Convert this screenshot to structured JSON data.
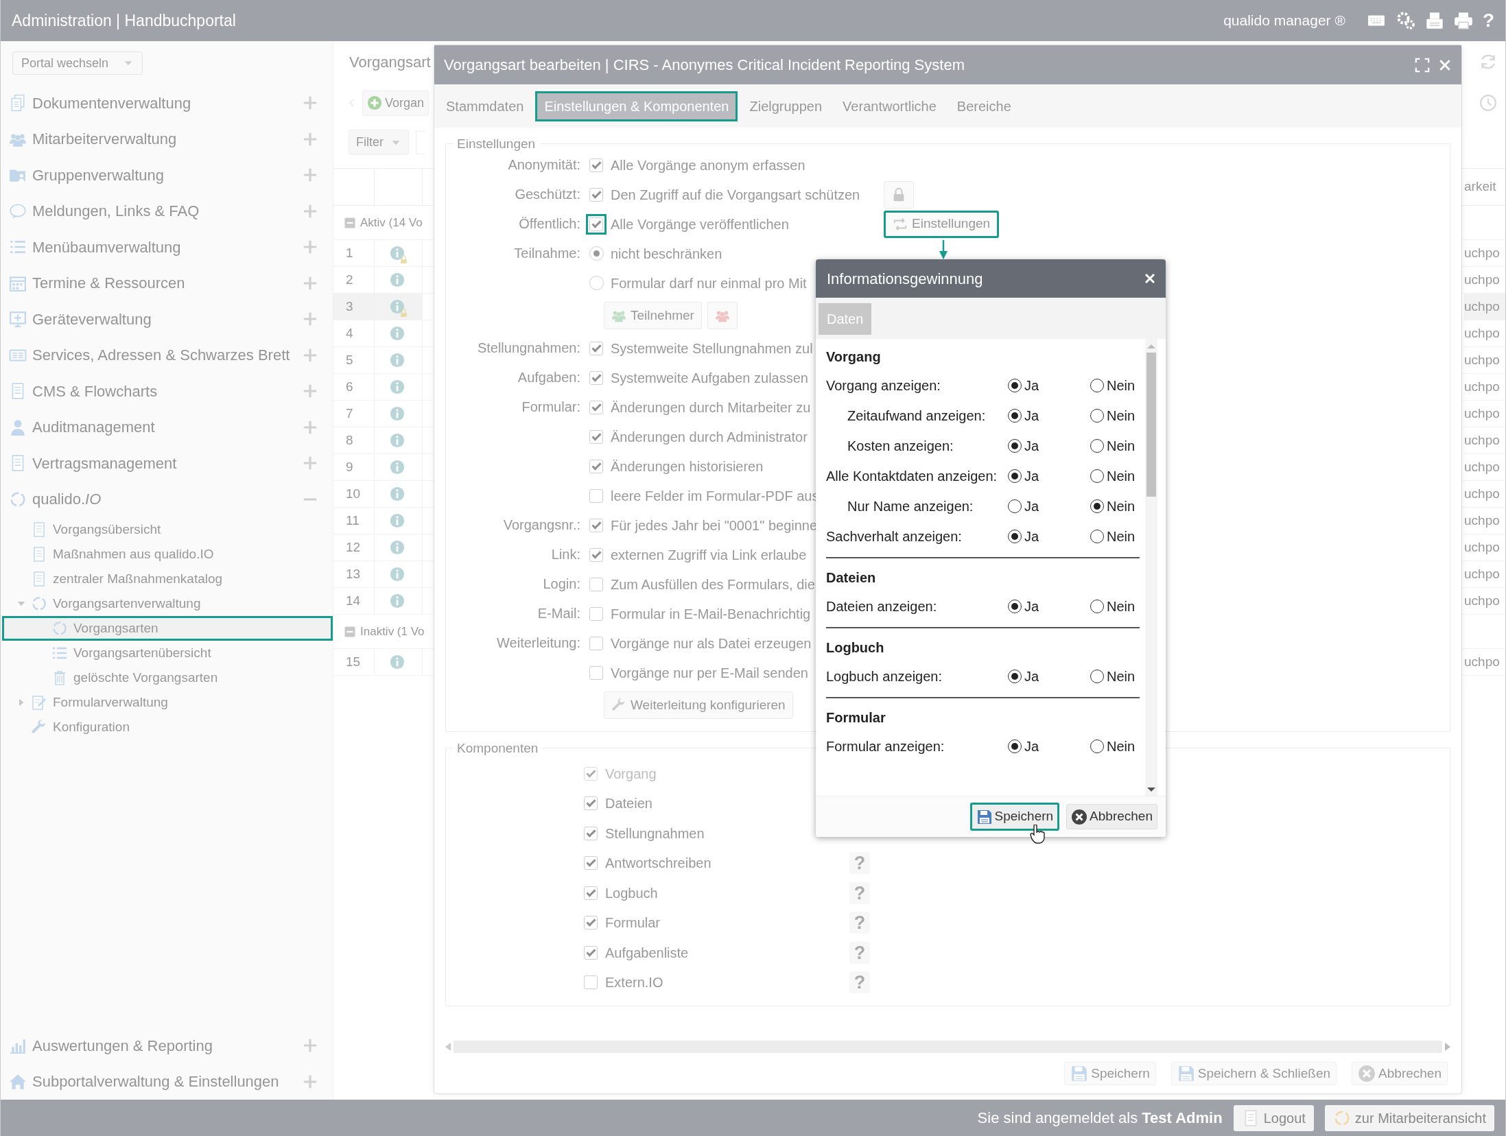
{
  "top_bar": {
    "title": "Administration | Handbuchportal",
    "product": "qualido manager ®",
    "help": "?"
  },
  "sidebar": {
    "portal_select": "Portal wechseln",
    "items": [
      {
        "label": "Dokumentenverwaltung",
        "expanded": false
      },
      {
        "label": "Mitarbeiterverwaltung",
        "expanded": false
      },
      {
        "label": "Gruppenverwaltung",
        "expanded": false
      },
      {
        "label": "Meldungen, Links & FAQ",
        "expanded": false
      },
      {
        "label": "Menübaumverwaltung",
        "expanded": false
      },
      {
        "label": "Termine & Ressourcen",
        "expanded": false
      },
      {
        "label": "Geräteverwaltung",
        "expanded": false
      },
      {
        "label": "Services, Adressen & Schwarzes Brett",
        "expanded": false
      },
      {
        "label": "CMS & Flowcharts",
        "expanded": false
      },
      {
        "label": "Auditmanagement",
        "expanded": false
      },
      {
        "label": "Vertragsmanagement",
        "expanded": false
      },
      {
        "label": "qualido.*IO*",
        "expanded": true,
        "children": [
          {
            "label": "Vorgangsübersicht",
            "selected": false
          },
          {
            "label": "Maßnahmen aus qualido.IO",
            "selected": false
          },
          {
            "label": "zentraler Maßnahmenkatalog",
            "selected": false
          },
          {
            "label": "Vorgangsartenverwaltung",
            "selected": false,
            "expanded": true,
            "children": [
              {
                "label": "Vorgangsarten",
                "selected": true,
                "highlighted": true
              },
              {
                "label": "Vorgangsartenübersicht",
                "selected": false,
                "highlighted": false
              },
              {
                "label": "gelöschte Vorgangsarten",
                "selected": false,
                "highlighted": false
              }
            ]
          },
          {
            "label": "Formularverwaltung",
            "selected": false,
            "expanded": false
          },
          {
            "label": "Konfiguration",
            "selected": false
          }
        ]
      }
    ],
    "bottom_items": [
      {
        "label": "Auswertungen & Reporting",
        "expanded": false
      },
      {
        "label": "Subportalverwaltung & Einstellungen",
        "expanded": false
      }
    ]
  },
  "list": {
    "title": "Vorgangsart",
    "add_button": "Vorgan",
    "filter": "Filter",
    "column_header": "arkeit",
    "groups": [
      {
        "label": "Aktiv (14 Vo",
        "expanded": true,
        "rows": [
          {
            "number": "1",
            "locked": true,
            "selected": false,
            "column_3": "uchpo"
          },
          {
            "number": "2",
            "locked": false,
            "selected": false,
            "column_3": "uchpo"
          },
          {
            "number": "3",
            "locked": true,
            "selected": true,
            "column_3": "uchpo"
          },
          {
            "number": "4",
            "locked": false,
            "selected": false,
            "column_3": "uchpo"
          },
          {
            "number": "5",
            "locked": false,
            "selected": false,
            "column_3": "uchpo"
          },
          {
            "number": "6",
            "locked": false,
            "selected": false,
            "column_3": "uchpo"
          },
          {
            "number": "7",
            "locked": false,
            "selected": false,
            "column_3": "uchpo"
          },
          {
            "number": "8",
            "locked": false,
            "selected": false,
            "column_3": "uchpo"
          },
          {
            "number": "9",
            "locked": false,
            "selected": false,
            "column_3": "uchpo"
          },
          {
            "number": "10",
            "locked": false,
            "selected": false,
            "column_3": "uchpo"
          },
          {
            "number": "11",
            "locked": false,
            "selected": false,
            "column_3": "uchpo"
          },
          {
            "number": "12",
            "locked": false,
            "selected": false,
            "column_3": "uchpo"
          },
          {
            "number": "13",
            "locked": false,
            "selected": false,
            "column_3": "uchpo"
          },
          {
            "number": "14",
            "locked": false,
            "selected": false,
            "column_3": "uchpo"
          }
        ]
      },
      {
        "label": "Inaktiv (1 Vo",
        "expanded": true,
        "rows": [
          {
            "number": "15",
            "locked": false,
            "selected": false,
            "column_3": "uchpo"
          }
        ]
      }
    ]
  },
  "dialog": {
    "title": "Vorgangsart bearbeiten | CIRS - Anonymes Critical Incident Reporting System",
    "tabs": [
      {
        "label": "Stammdaten",
        "selected": false,
        "highlighted": false
      },
      {
        "label": "Einstellungen & Komponenten",
        "selected": true,
        "highlighted": true
      },
      {
        "label": "Zielgruppen",
        "selected": false,
        "highlighted": false
      },
      {
        "label": "Verantwortliche",
        "selected": false,
        "highlighted": false
      },
      {
        "label": "Bereiche",
        "selected": false,
        "highlighted": false
      }
    ],
    "settings": {
      "legend": "Einstellungen",
      "groups": [
        {
          "label": "Anonymität:",
          "items": [
            {
              "kind": "checkbox",
              "text": "Alle Vorgänge anonym erfassen",
              "checked": true,
              "highlighted": false
            }
          ]
        },
        {
          "label": "Geschützt:",
          "items": [
            {
              "kind": "checkbox",
              "text": "Den Zugriff auf die Vorgangsart schützen",
              "checked": true,
              "highlighted": false,
              "button": {
                "kind": "lock",
                "highlighted": false
              }
            }
          ]
        },
        {
          "label": "Öffentlich:",
          "items": [
            {
              "kind": "checkbox",
              "text": "Alle Vorgänge veröffentlichen",
              "checked": true,
              "highlighted": true,
              "button": {
                "kind": "settings",
                "label": "Einstellungen",
                "highlighted": true
              }
            }
          ]
        },
        {
          "label": "Teilnahme:",
          "items": [
            {
              "kind": "radio",
              "text": "nicht beschränken",
              "selected": true,
              "highlighted": false
            },
            {
              "kind": "radio",
              "text": "Formular darf nur einmal pro Mit",
              "selected": false,
              "highlighted": false
            },
            {
              "kind": "buttons",
              "buttons": [
                {
                  "kind": "participants",
                  "label": "Teilnehmer",
                  "highlighted": false
                },
                {
                  "kind": "participants-remove",
                  "highlighted": false
                }
              ]
            }
          ]
        },
        {
          "label": "Stellungnahmen:",
          "items": [
            {
              "kind": "checkbox",
              "text": "Systemweite Stellungnahmen zul",
              "checked": true,
              "highlighted": false
            }
          ]
        },
        {
          "label": "Aufgaben:",
          "items": [
            {
              "kind": "checkbox",
              "text": "Systemweite Aufgaben zulassen",
              "checked": true,
              "highlighted": false
            }
          ]
        },
        {
          "label": "Formular:",
          "items": [
            {
              "kind": "checkbox",
              "text": "Änderungen durch Mitarbeiter zu",
              "checked": true,
              "highlighted": false
            },
            {
              "kind": "checkbox",
              "text": "Änderungen durch Administrator",
              "checked": true,
              "highlighted": false
            },
            {
              "kind": "checkbox",
              "text": "Änderungen historisieren",
              "checked": true,
              "highlighted": false
            },
            {
              "kind": "checkbox",
              "text": "leere Felder im Formular-PDF aus",
              "checked": false,
              "highlighted": false
            }
          ]
        },
        {
          "label": "Vorgangsnr.:",
          "items": [
            {
              "kind": "checkbox",
              "text": "Für jedes Jahr bei \"0001\" beginne",
              "checked": true,
              "highlighted": false
            }
          ]
        },
        {
          "label": "Link:",
          "items": [
            {
              "kind": "checkbox",
              "text": "externen Zugriff via Link erlaube",
              "checked": true,
              "highlighted": false
            }
          ]
        },
        {
          "label": "Login:",
          "items": [
            {
              "kind": "checkbox",
              "text": "Zum Ausfüllen des Formulars, die",
              "checked": false,
              "highlighted": false
            }
          ]
        },
        {
          "label": "E-Mail:",
          "items": [
            {
              "kind": "checkbox",
              "text": "Formular in E-Mail-Benachrichtig",
              "checked": false,
              "highlighted": false
            }
          ]
        },
        {
          "label": "Weiterleitung:",
          "items": [
            {
              "kind": "checkbox",
              "text": "Vorgänge nur als Datei erzeugen",
              "checked": false,
              "highlighted": false
            },
            {
              "kind": "checkbox",
              "text": "Vorgänge nur per E-Mail senden",
              "checked": false,
              "highlighted": false
            },
            {
              "kind": "buttons",
              "buttons": [
                {
                  "kind": "forwarding",
                  "label": "Weiterleitung konfigurieren",
                  "highlighted": false
                }
              ]
            }
          ]
        }
      ]
    },
    "components": {
      "legend": "Komponenten",
      "items": [
        {
          "text": "Vorgang",
          "checked": true,
          "disabled": true
        },
        {
          "text": "Dateien",
          "checked": true,
          "disabled": false
        },
        {
          "text": "Stellungnahmen",
          "checked": true,
          "disabled": false
        },
        {
          "text": "Antwortschreiben",
          "checked": true,
          "disabled": false,
          "help_button": "?"
        },
        {
          "text": "Logbuch",
          "checked": true,
          "disabled": false,
          "help_button": "?"
        },
        {
          "text": "Formular",
          "checked": true,
          "disabled": false,
          "help_button": "?"
        },
        {
          "text": "Aufgabenliste",
          "checked": true,
          "disabled": false,
          "help_button": "?"
        },
        {
          "text": "Extern.IO",
          "checked": false,
          "disabled": false,
          "help_button": "?"
        }
      ]
    },
    "buttons": [
      {
        "kind": "save",
        "label": "Speichern"
      },
      {
        "kind": "save",
        "label": "Speichern & Schließen"
      },
      {
        "kind": "cancel",
        "label": "Abbrechen"
      }
    ]
  },
  "popup": {
    "title": "Informationsgewinnung",
    "tabs": [
      {
        "label": "Daten",
        "selected": true
      }
    ],
    "sections": [
      {
        "heading": "Vorgang",
        "rows": [
          {
            "label": "Vorgang anzeigen:",
            "options": [
              {
                "label": "Ja",
                "selected": true
              },
              {
                "label": "Nein",
                "selected": false
              }
            ],
            "children": [
              {
                "label": "Zeitaufwand anzeigen:",
                "options": [
                  {
                    "label": "Ja",
                    "selected": true
                  },
                  {
                    "label": "Nein",
                    "selected": false
                  }
                ]
              },
              {
                "label": "Kosten anzeigen:",
                "options": [
                  {
                    "label": "Ja",
                    "selected": true
                  },
                  {
                    "label": "Nein",
                    "selected": false
                  }
                ]
              }
            ]
          },
          {
            "label": "Alle Kontaktdaten anzeigen:",
            "options": [
              {
                "label": "Ja",
                "selected": true
              },
              {
                "label": "Nein",
                "selected": false
              }
            ],
            "children": [
              {
                "label": "Nur Name anzeigen:",
                "options": [
                  {
                    "label": "Ja",
                    "selected": false
                  },
                  {
                    "label": "Nein",
                    "selected": true
                  }
                ]
              }
            ]
          },
          {
            "label": "Sachverhalt anzeigen:",
            "options": [
              {
                "label": "Ja",
                "selected": true
              },
              {
                "label": "Nein",
                "selected": false
              }
            ]
          }
        ]
      },
      {
        "heading": "Dateien",
        "rows": [
          {
            "label": "Dateien anzeigen:",
            "options": [
              {
                "label": "Ja",
                "selected": true
              },
              {
                "label": "Nein",
                "selected": false
              }
            ]
          }
        ]
      },
      {
        "heading": "Logbuch",
        "rows": [
          {
            "label": "Logbuch anzeigen:",
            "options": [
              {
                "label": "Ja",
                "selected": true
              },
              {
                "label": "Nein",
                "selected": false
              }
            ]
          }
        ]
      },
      {
        "heading": "Formular",
        "rows": [
          {
            "label": "Formular anzeigen:",
            "options": [
              {
                "label": "Ja",
                "selected": true
              },
              {
                "label": "Nein",
                "selected": false
              }
            ]
          }
        ]
      }
    ],
    "buttons": [
      {
        "kind": "save",
        "label": "Speichern",
        "highlighted": true
      },
      {
        "kind": "cancel",
        "label": "Abbrechen",
        "highlighted": false
      }
    ]
  },
  "status_bar": {
    "text": "Sie sind angemeldet als **Test Admin**",
    "buttons": [
      {
        "kind": "logout",
        "label": "Logout"
      },
      {
        "kind": "staff-view",
        "label": "zur Mitarbeiteransicht"
      }
    ]
  }
}
